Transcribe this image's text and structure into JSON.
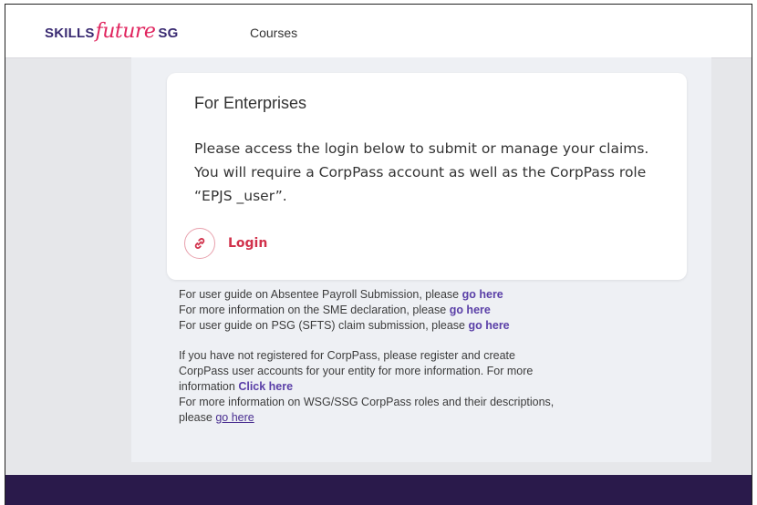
{
  "header": {
    "logo": {
      "skills": "SKILLS",
      "future": "future",
      "sg": "SG"
    },
    "nav_courses": "Courses"
  },
  "card": {
    "title": "For Enterprises",
    "body": "Please access the login below to submit or manage your claims. You will require a CorpPass account as well as the CorpPass role “EPJS _user”.",
    "login_label": "Login",
    "login_icon": "link-icon"
  },
  "info": {
    "absentee_text": "For user guide on Absentee Payroll Submission, please ",
    "absentee_link": "go here",
    "sme_text": "For more information on the SME declaration, please ",
    "sme_link": "go here",
    "psg_text": "For user guide on PSG (SFTS) claim submission, please ",
    "psg_link": "go here",
    "register_line1": "If you have not registered for CorpPass, please register and create",
    "register_line2": "CorpPass user accounts for your entity for more information. For more",
    "register_line3": "information ",
    "register_link": "Click here",
    "roles_line1": "For more information on WSG/SSG CorpPass roles and their descriptions,",
    "roles_line2": "please ",
    "roles_link": "go here"
  },
  "colors": {
    "brand_purple": "#3a2b72",
    "brand_pink": "#e0245e",
    "login_red": "#d1314b",
    "link_purple": "#5a3fa7",
    "footer": "#2a1a4b"
  }
}
